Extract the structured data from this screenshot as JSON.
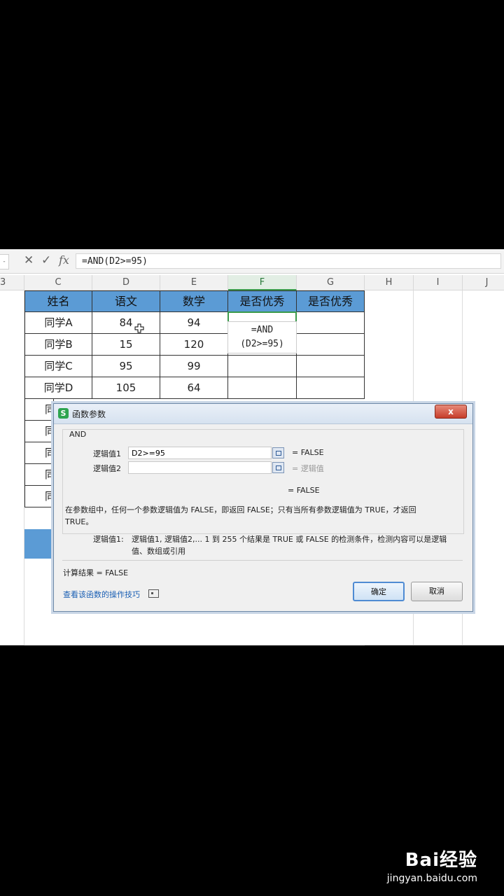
{
  "formula_bar": {
    "namebox": "-",
    "cancel_icon": "✕",
    "confirm_icon": "✓",
    "fx_label": "fx",
    "formula": "=AND(D2>=95)"
  },
  "row_header_edge": "3",
  "columns": [
    "C",
    "D",
    "E",
    "F",
    "G",
    "H",
    "I",
    "J"
  ],
  "table": {
    "headers": [
      "姓名",
      "语文",
      "数学",
      "是否优秀",
      "是否优秀"
    ],
    "rows": [
      [
        "同学A",
        "84",
        "94",
        "",
        ""
      ],
      [
        "同学B",
        "15",
        "120",
        "",
        ""
      ],
      [
        "同学C",
        "95",
        "99",
        "",
        ""
      ],
      [
        "同学D",
        "105",
        "64",
        "",
        ""
      ]
    ],
    "hidden_names": [
      "同",
      "同",
      "同",
      "同",
      "同"
    ],
    "editing_cell": {
      "line1": "=AND",
      "line2": "(D2>=95)"
    }
  },
  "dialog": {
    "title": "函数参数",
    "close_label": "x",
    "function_name": "AND",
    "arg1_label": "逻辑值1",
    "arg1_value": "D2>=95",
    "arg1_result": "= FALSE",
    "arg2_label": "逻辑值2",
    "arg2_value": "",
    "arg2_result": "= 逻辑值",
    "overall_result": "= FALSE",
    "description_line1": "在参数组中，任何一个参数逻辑值为 FALSE，即返回 FALSE；只有当所有参数逻辑值为 TRUE，才返回",
    "description_line2": "TRUE。",
    "param_label": "逻辑值1:",
    "param_help_line1": "逻辑值1, 逻辑值2,... 1 到 255 个结果是 TRUE 或 FALSE 的检测条件，检测内容可以是逻辑",
    "param_help_line2": "值、数组或引用",
    "calc_result": "计算结果 = FALSE",
    "help_link": "查看该函数的操作技巧",
    "ok_label": "确定",
    "cancel_label": "取消"
  },
  "watermark": {
    "main": "Bai经验",
    "sub": "jingyan.baidu.com"
  },
  "colors": {
    "header_fill": "#5b9bd5",
    "selection": "#3a9a4a"
  }
}
